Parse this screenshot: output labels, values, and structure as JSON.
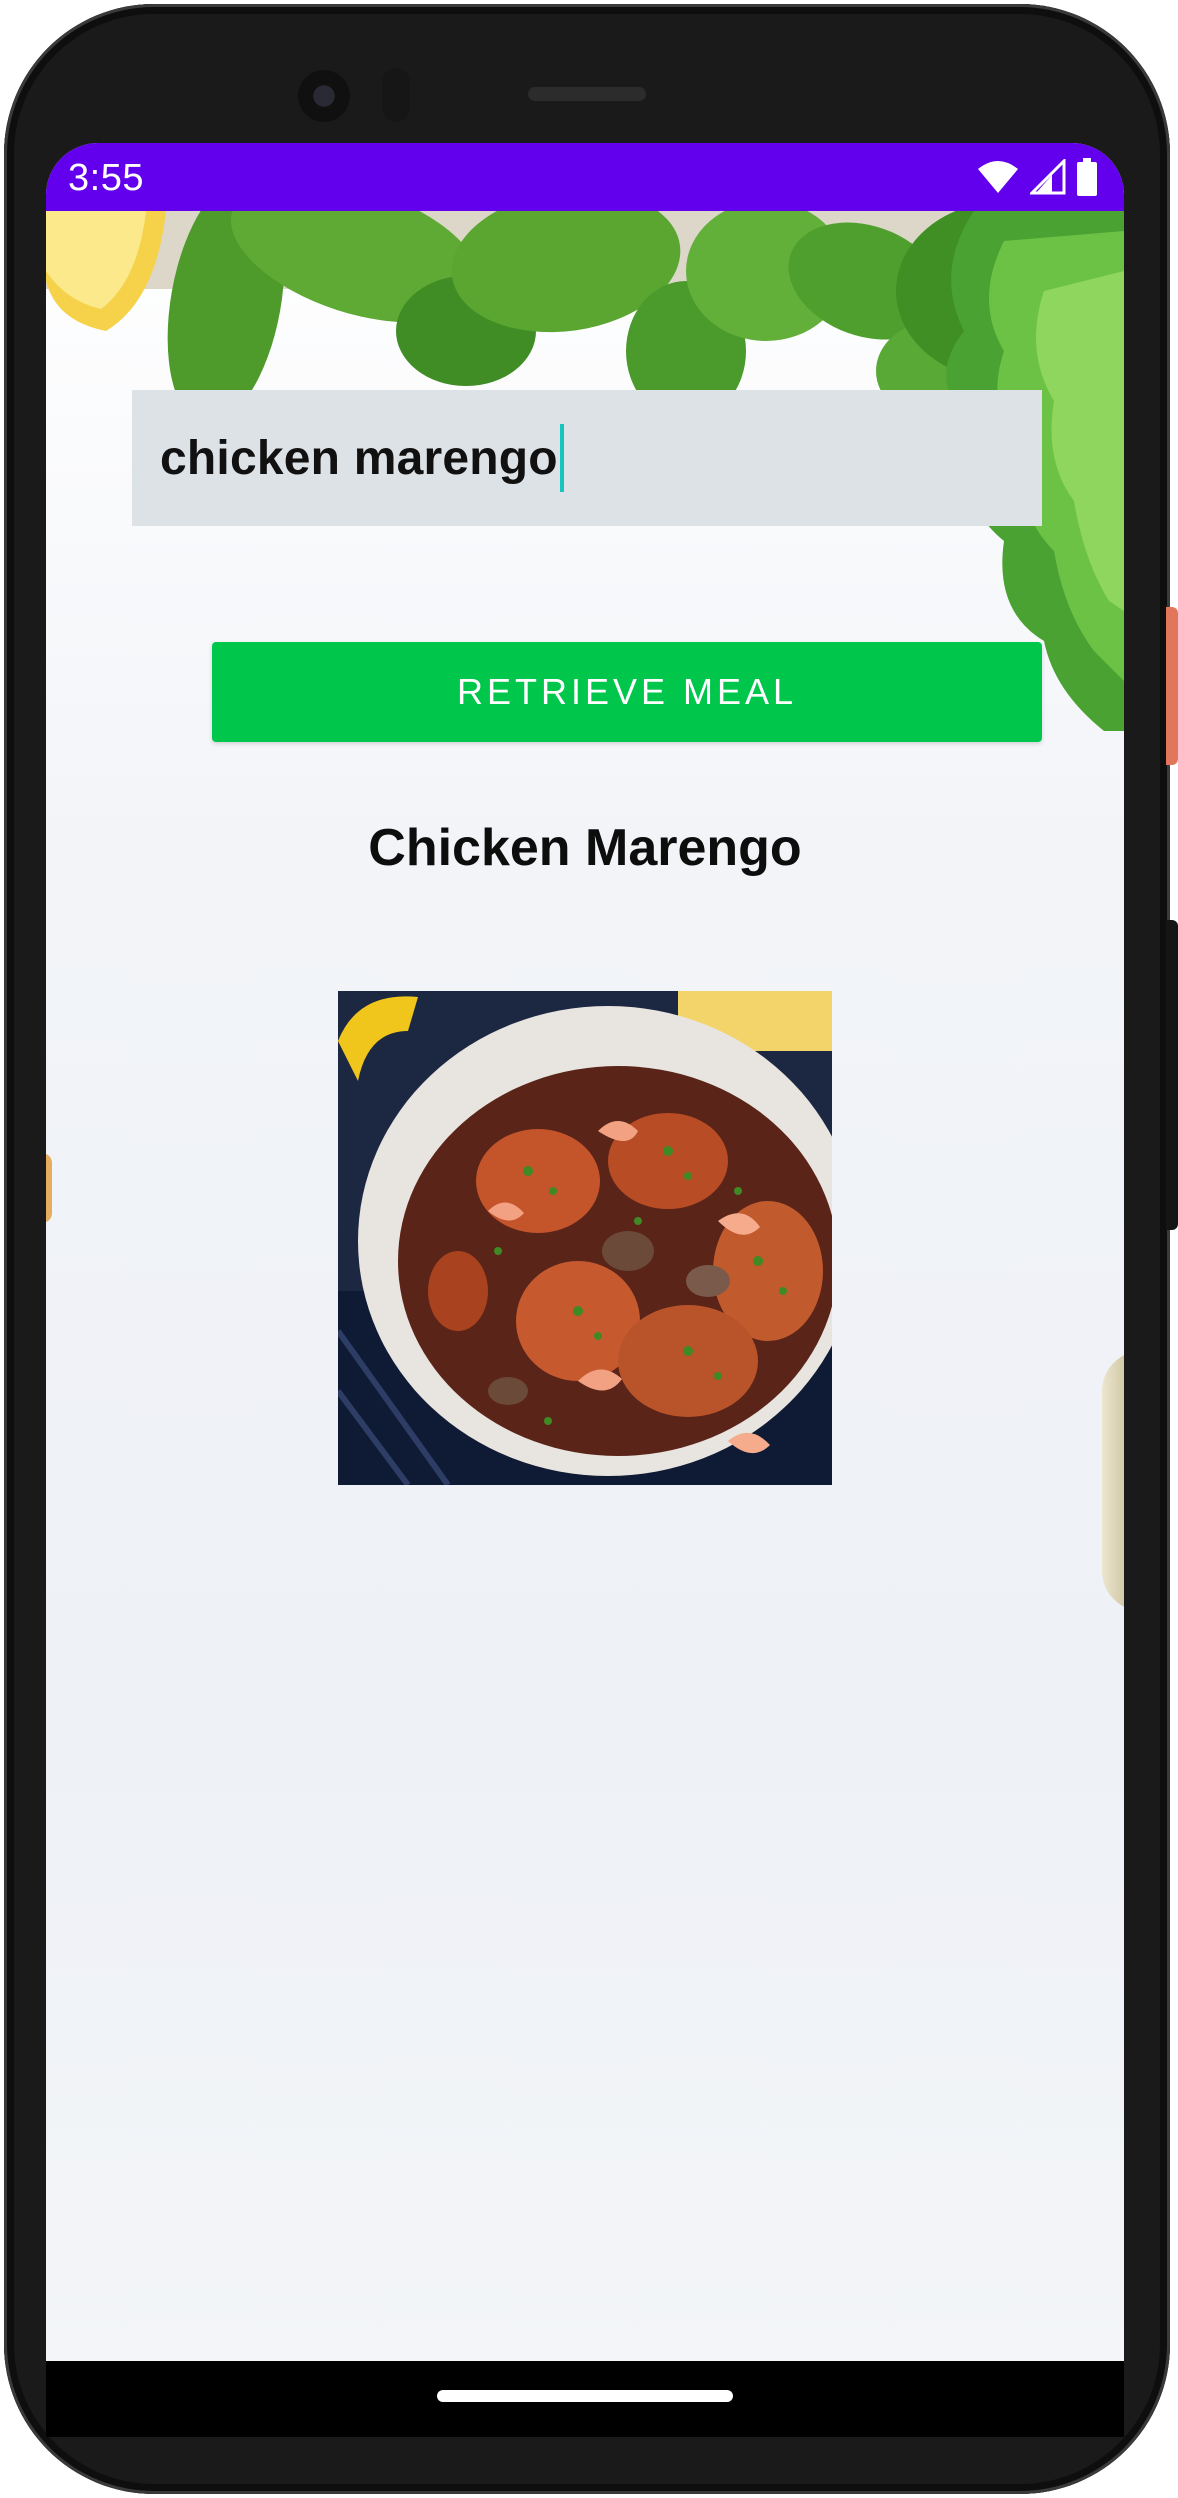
{
  "status_bar": {
    "time": "3:55",
    "icons": [
      "wifi-icon",
      "cell-signal-icon",
      "battery-icon"
    ],
    "color": "#6200ee"
  },
  "search": {
    "value": "chicken marengo"
  },
  "actions": {
    "retrieve_label": "RETRIEVE MEAL",
    "retrieve_color": "#00c74c"
  },
  "meal": {
    "title": "Chicken Marengo",
    "image": "chicken-marengo-photo"
  },
  "navigation": {
    "home_indicator": "home-indicator"
  }
}
